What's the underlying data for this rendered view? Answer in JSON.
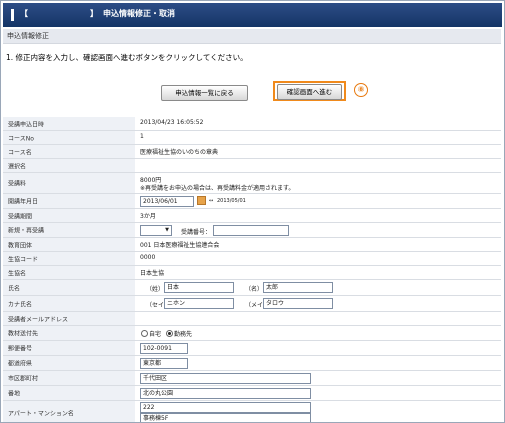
{
  "header": {
    "bracket_left": "【",
    "bracket_right": "】",
    "title": "申込情報修正・取消"
  },
  "section": {
    "title": "申込情報修正"
  },
  "instruction": "1. 修正内容を入力し、確認画面へ進むボタンをクリックしてください。",
  "buttons": {
    "back_label": "申込情報一覧に戻る",
    "confirm_label": "確認画面へ進む",
    "marker": "⑧"
  },
  "form": {
    "applied_at": {
      "label": "受講申込日時",
      "value": "2013/04/23 16:05:52"
    },
    "course_no": {
      "label": "コースNo",
      "value": "1"
    },
    "course_name": {
      "label": "コース名",
      "value": "医療福祉生協のいのちの章典"
    },
    "option_name": {
      "label": "選択名",
      "value": ""
    },
    "fee": {
      "label": "受講料",
      "value": "8000円",
      "note": "※再受講をお申込の場合は、再受講料金が適用されます。"
    },
    "start_month": {
      "label": "開講年月日",
      "value": "2013/06/01",
      "hint": "2013/05/01"
    },
    "duration": {
      "label": "受講期間",
      "value": "3か月"
    },
    "new_repeat": {
      "label": "新規・再受講",
      "select_value": "",
      "student_no_label": "受講番号：",
      "student_no_value": ""
    },
    "org": {
      "label": "教育団体",
      "value": "001  日本医療福祉生協連合会"
    },
    "coop_code": {
      "label": "生協コード",
      "value": "0000"
    },
    "coop_name": {
      "label": "生協名",
      "value": "日本生協"
    },
    "name": {
      "label": "氏名",
      "last_label": "（姓）",
      "last_value": "日本",
      "first_label": "（名）",
      "first_value": "太郎"
    },
    "kana": {
      "label": "カナ氏名",
      "last_label": "（セイ）",
      "last_value": "ニホン",
      "first_label": "（メイ）",
      "first_value": "タロウ"
    },
    "email": {
      "label": "受講者メールアドレス",
      "value": ""
    },
    "ship_to": {
      "label": "教材送付先",
      "option_home": "自宅",
      "option_work": "勤務先",
      "selected": "勤務先"
    },
    "zip": {
      "label": "郵便番号",
      "value": "102-0091"
    },
    "pref": {
      "label": "都道府県",
      "value": "東京都"
    },
    "city": {
      "label": "市区郡町村",
      "value": "千代田区"
    },
    "address": {
      "label": "番地",
      "value": "北の丸公園"
    },
    "building": {
      "label": "アパート・マンション名",
      "value1": "222",
      "value2": "事務棟5F"
    }
  }
}
